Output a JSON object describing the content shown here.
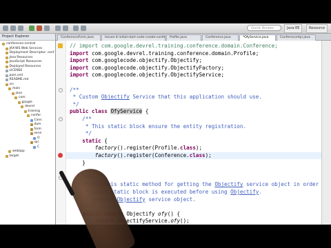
{
  "toolbar": {
    "search_placeholder": "Quick Access",
    "perspectives": [
      "Java EE",
      "Resource"
    ]
  },
  "explorer": {
    "title": "Project Explorer",
    "items": [
      {
        "label": "conference-central",
        "icon": "project-icon",
        "depth": 0
      },
      {
        "label": "JAX-WS Web Services",
        "icon": "folder-icon",
        "depth": 1
      },
      {
        "label": "Deployment Descriptor: conf",
        "icon": "folder-icon",
        "depth": 1
      },
      {
        "label": "Java Resources",
        "icon": "folder-icon",
        "depth": 1
      },
      {
        "label": "JavaScript Resources",
        "icon": "folder-icon",
        "depth": 1
      },
      {
        "label": "Deployed Resources",
        "icon": "folder-icon",
        "depth": 1
      },
      {
        "label": "LICENSE",
        "icon": "file-icon",
        "depth": 1
      },
      {
        "label": "pom.xml",
        "icon": "file-icon",
        "depth": 1
      },
      {
        "label": "README.md",
        "icon": "file-icon",
        "depth": 1
      },
      {
        "label": "src",
        "icon": "folder-icon",
        "depth": 1
      },
      {
        "label": "main",
        "icon": "folder-icon",
        "depth": 2
      },
      {
        "label": "java",
        "icon": "folder-icon",
        "depth": 3
      },
      {
        "label": "com",
        "icon": "folder-icon",
        "depth": 4
      },
      {
        "label": "google",
        "icon": "folder-icon",
        "depth": 5
      },
      {
        "label": "devrel",
        "icon": "folder-icon",
        "depth": 6
      },
      {
        "label": "training",
        "icon": "folder-icon",
        "depth": 7
      },
      {
        "label": "confer",
        "icon": "folder-icon",
        "depth": 8
      },
      {
        "label": "Cons",
        "icon": "java-icon",
        "depth": 9
      },
      {
        "label": "dom",
        "icon": "package-icon",
        "depth": 9
      },
      {
        "label": "form",
        "icon": "package-icon",
        "depth": 9
      },
      {
        "label": "servi",
        "icon": "package-icon",
        "depth": 9
      },
      {
        "label": "O",
        "icon": "java-icon",
        "depth": 10
      },
      {
        "label": "spi",
        "icon": "package-icon",
        "depth": 9
      },
      {
        "label": "C",
        "icon": "java-icon",
        "depth": 10
      },
      {
        "label": "webapp",
        "icon": "folder-icon",
        "depth": 2
      },
      {
        "label": "target",
        "icon": "folder-icon",
        "depth": 1
      }
    ]
  },
  "editor": {
    "tabs": [
      {
        "label": "ConferenceForm.java",
        "active": false
      },
      {
        "label": "lesson-4-initial-start-code-create-conference",
        "active": false
      },
      {
        "label": "Profile.java",
        "active": false
      },
      {
        "label": "Conference.java",
        "active": false
      },
      {
        "label": "*OfyService.java",
        "active": true
      },
      {
        "label": "ConferenceApi.java",
        "active": false
      }
    ],
    "code_lines": [
      "// import com.google.devrel.training.conference.domain.Conference;",
      "import com.google.devrel.training.conference.domain.Profile;",
      "import com.googlecode.objectify.Objectify;",
      "import com.googlecode.objectify.ObjectifyFactory;",
      "import com.googlecode.objectify.ObjectifyService;",
      "",
      "/**",
      " * Custom Objectify Service that this application should use.",
      " */",
      "public class OfyService {",
      "    /**",
      "     * This static block ensure the entity registration.",
      "     */",
      "    static {",
      "        factory().register(Profile.class);",
      "        factory().register(Conference.class);",
      "    }",
      "",
      "    /**",
      "     * Use this static method for getting the Objectify service object in order to make sure the",
      "     * above static block is executed before using Objectify.",
      "     * @return Objectify service object.",
      "     */",
      "    public static Objectify ofy() {",
      "        return ObjectifyService.ofy();"
    ]
  },
  "colors": {
    "keyword": "#7f0055",
    "comment": "#3f7f5f",
    "javadoc": "#3f5fbf",
    "error_marker": "#d93a3a",
    "warning_marker": "#e8b428"
  }
}
